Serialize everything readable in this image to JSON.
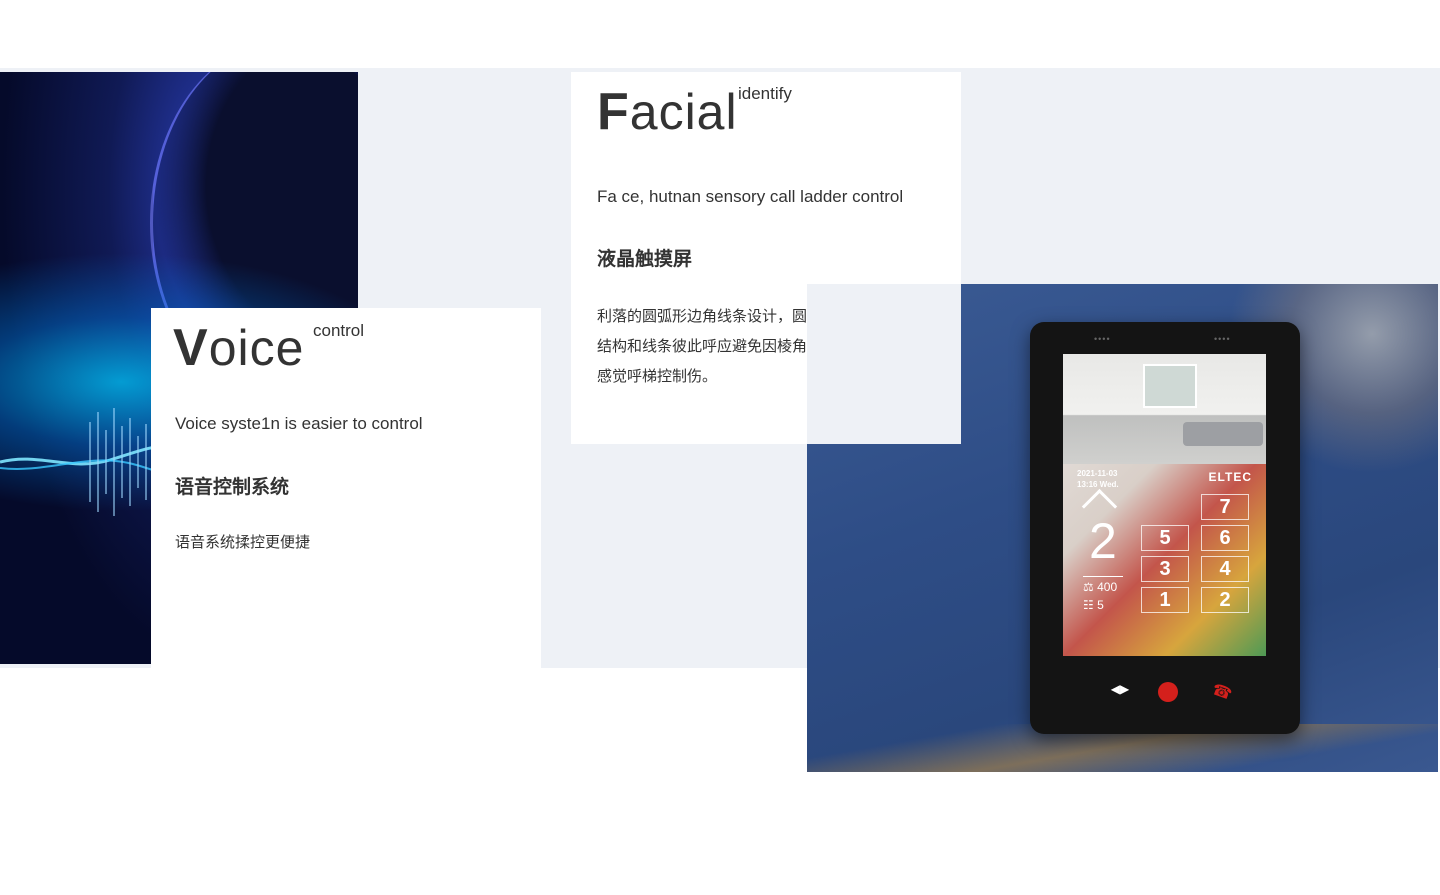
{
  "voice": {
    "title_cap": "V",
    "title_rest": "oice",
    "sup": "control",
    "subtitle_en": "Voice syste1n is easier to control",
    "subtitle_cn": "语音控制系统",
    "desc": "语音系统揉控更便捷"
  },
  "facial": {
    "title_cap": "F",
    "title_rest": "acial",
    "sup": "identify",
    "subtitle_en": "Fa ce, hutnan sensory call ladder control",
    "subtitle_cn": "液晶触摸屏",
    "desc_line1": "利落的圆弧形边角线条设计，圆润中带着冷静感，",
    "desc_line2": "结构和线条彼此呼应避免因棱角磕碰受面部，人体",
    "desc_line3": "感觉呼梯控制伤。"
  },
  "device": {
    "date": "2021-11-03",
    "time": "13:16 Wed.",
    "brand": "ELTEC",
    "floor": "2",
    "load": "400",
    "persons": "5",
    "keys": [
      "7",
      "5",
      "6",
      "3",
      "4",
      "1",
      "2"
    ]
  },
  "colors": {
    "band_bg": "#eef1f6",
    "text": "#333333",
    "alarm_red": "#d4201c"
  }
}
